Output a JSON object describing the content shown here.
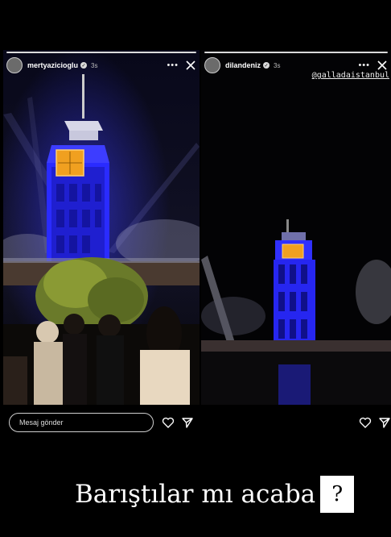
{
  "stories": [
    {
      "username": "mertyazicioglu",
      "timestamp": "3s",
      "more_icon": "more-dots-icon",
      "close_icon": "close-icon",
      "verified": true
    },
    {
      "username": "dilandeniz",
      "timestamp": "3s",
      "mention": "@galladaistanbul",
      "more_icon": "more-dots-icon",
      "close_icon": "close-icon",
      "verified": true
    }
  ],
  "reply": {
    "placeholder": "Mesaj gönder",
    "like_icon": "heart-icon",
    "share_icon": "send-icon"
  },
  "caption": {
    "text": "Barıştılar mı acaba",
    "mark": "?"
  },
  "colors": {
    "tower_blue": "#2a2bff",
    "clock_face": "#f0a020",
    "background": "#000000"
  }
}
